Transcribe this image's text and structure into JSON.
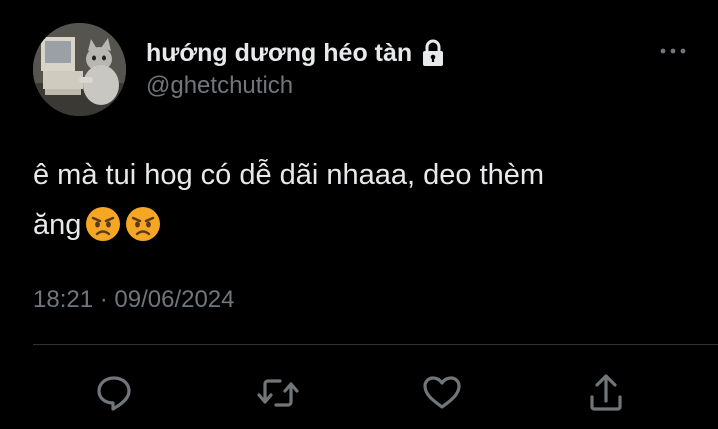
{
  "user": {
    "display_name": "hướng dương héo tàn",
    "handle": "@ghetchutich",
    "protected_icon": "lock-icon",
    "avatar_icon": "avatar-cat-at-computer"
  },
  "tweet": {
    "text_line_1": "ê mà tui hog có dễ dãi nhaaa, deo thèm",
    "text_line_2": "ăng",
    "emojis": [
      "angry-face-emoji",
      "angry-face-emoji"
    ],
    "timestamp": "18:21 · 09/06/2024"
  },
  "actions": [
    {
      "icon": "reply-icon"
    },
    {
      "icon": "retweet-icon"
    },
    {
      "icon": "like-icon"
    },
    {
      "icon": "share-icon"
    }
  ],
  "menu": {
    "icon": "more-options-icon"
  },
  "colors": {
    "background": "#000000",
    "primary_text": "#e7e9ea",
    "secondary_text": "#71767b",
    "divider": "#2f3336",
    "emoji_face": "#f5a623"
  }
}
